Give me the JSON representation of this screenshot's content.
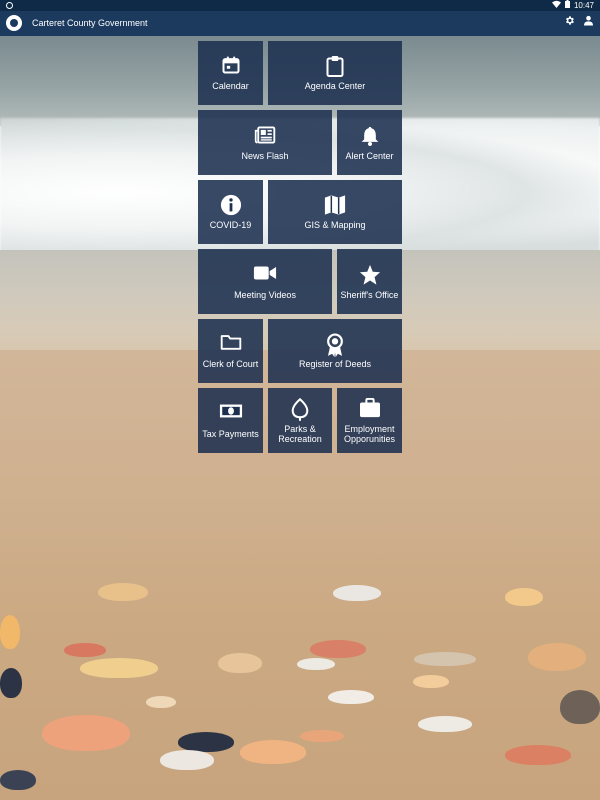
{
  "status_bar": {
    "time": "10:47",
    "icons": [
      "app-notification-icon",
      "wifi-icon",
      "battery-icon"
    ]
  },
  "app_bar": {
    "title": "Carteret County Government",
    "icons": [
      "county-seal-icon",
      "settings-gear-icon",
      "account-person-icon"
    ]
  },
  "tiles": [
    {
      "label": "Calendar",
      "icon": "calendar-icon"
    },
    {
      "label": "Agenda Center",
      "icon": "clipboard-icon"
    },
    {
      "label": "News Flash",
      "icon": "newspaper-icon"
    },
    {
      "label": "Alert Center",
      "icon": "bell-icon"
    },
    {
      "label": "COVID-19",
      "icon": "info-icon"
    },
    {
      "label": "GIS & Mapping",
      "icon": "map-icon"
    },
    {
      "label": "Meeting Videos",
      "icon": "video-camera-icon"
    },
    {
      "label": "Sheriff's Office",
      "icon": "star-icon"
    },
    {
      "label": "Clerk of Court",
      "icon": "folder-icon"
    },
    {
      "label": "Register of Deeds",
      "icon": "award-ribbon-icon"
    },
    {
      "label": "Tax Payments",
      "icon": "money-bill-icon"
    },
    {
      "label": "Parks &\nRecreation",
      "icon": "leaf-icon"
    },
    {
      "label": "Employment\nOpporunities",
      "icon": "briefcase-icon"
    }
  ],
  "colors": {
    "status_bar": "#0f2a47",
    "app_bar": "#1c3a5e",
    "tile": "#1c3050"
  }
}
